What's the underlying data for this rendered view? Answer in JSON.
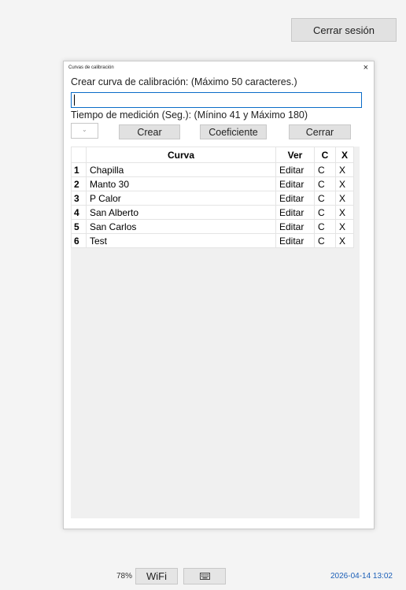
{
  "header": {
    "logout_label": "Cerrar sesión"
  },
  "dialog": {
    "title": "Curvas de calibración",
    "close_glyph": "×",
    "name_prompt": "Crear curva de calibración: (Máximo 50 caracteres.)",
    "name_value": "",
    "time_label": "Tiempo de medición (Seg.): (Mínino 41 y Máximo 180)",
    "time_select_value": "",
    "buttons": {
      "create": "Crear",
      "coefficient": "Coeficiente",
      "close": "Cerrar"
    },
    "table": {
      "headers": [
        "",
        "Curva",
        "Ver",
        "C",
        "X"
      ],
      "rows": [
        {
          "index": "1",
          "name": "Chapilla",
          "ver": "Editar",
          "c": "C",
          "x": "X"
        },
        {
          "index": "2",
          "name": "Manto 30",
          "ver": "Editar",
          "c": "C",
          "x": "X"
        },
        {
          "index": "3",
          "name": "P Calor",
          "ver": "Editar",
          "c": "C",
          "x": "X"
        },
        {
          "index": "4",
          "name": "San Alberto",
          "ver": "Editar",
          "c": "C",
          "x": "X"
        },
        {
          "index": "5",
          "name": "San Carlos",
          "ver": "Editar",
          "c": "C",
          "x": "X"
        },
        {
          "index": "6",
          "name": "Test",
          "ver": "Editar",
          "c": "C",
          "x": "X"
        }
      ]
    }
  },
  "status_bar": {
    "battery": "78%",
    "wifi_label": "WiFi",
    "keyboard_icon": "keyboard-icon",
    "datetime": "2026-04-14 13:02"
  },
  "colors": {
    "accent": "#0a6cc8",
    "datetime": "#1b5fb8",
    "button": "#e1e1e1"
  }
}
